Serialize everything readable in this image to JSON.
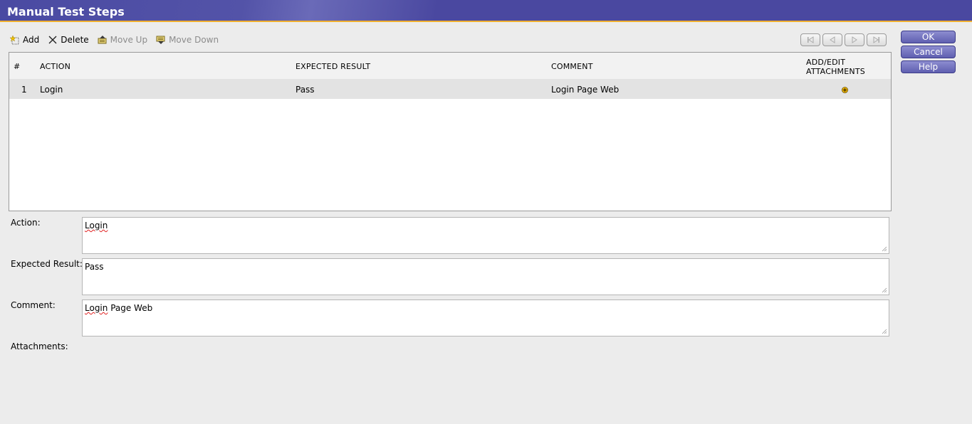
{
  "header": {
    "title": "Manual Test Steps"
  },
  "toolbar": {
    "add": "Add",
    "delete": "Delete",
    "move_up": "Move Up",
    "move_down": "Move Down"
  },
  "side_buttons": {
    "ok": "OK",
    "cancel": "Cancel",
    "help": "Help"
  },
  "grid": {
    "columns": [
      "#",
      "ACTION",
      "EXPECTED RESULT",
      "COMMENT",
      "ADD/EDIT",
      "ATTACHMENTS"
    ],
    "rows": [
      {
        "num": "1",
        "action": "Login",
        "expected": "Pass",
        "comment": "Login Page Web"
      }
    ]
  },
  "form": {
    "action_label": "Action:",
    "action_value_a": "Login",
    "expected_label": "Expected Result:",
    "expected_value": "Pass",
    "comment_label": "Comment:",
    "comment_value_a": "Login",
    "comment_value_b": " Page Web",
    "attachments_label": "Attachments:"
  },
  "colors": {
    "header": "#4a48a0",
    "header_border": "#f0b030",
    "button": "#6a6ab8"
  }
}
